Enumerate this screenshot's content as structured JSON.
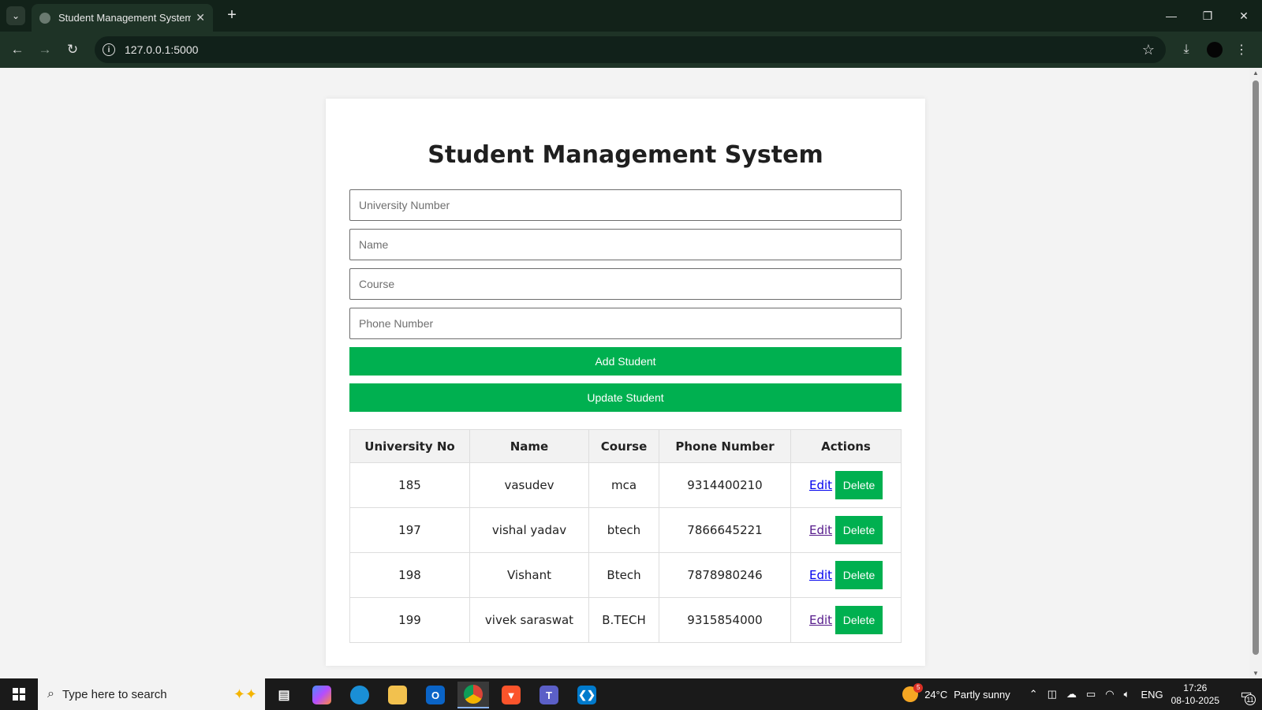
{
  "browser": {
    "tab_title": "Student Management System",
    "url": "127.0.0.1:5000"
  },
  "page": {
    "title": "Student Management System",
    "form": {
      "university_number_placeholder": "University Number",
      "name_placeholder": "Name",
      "course_placeholder": "Course",
      "phone_placeholder": "Phone Number",
      "add_label": "Add Student",
      "update_label": "Update Student"
    },
    "table": {
      "headers": [
        "University No",
        "Name",
        "Course",
        "Phone Number",
        "Actions"
      ],
      "rows": [
        {
          "university_no": "185",
          "name": "vasudev",
          "course": "mca",
          "phone": "9314400210"
        },
        {
          "university_no": "197",
          "name": "vishal yadav",
          "course": "btech",
          "phone": "7866645221"
        },
        {
          "university_no": "198",
          "name": "Vishant",
          "course": "Btech",
          "phone": "7878980246"
        },
        {
          "university_no": "199",
          "name": "vivek saraswat",
          "course": "B.TECH",
          "phone": "9315854000"
        }
      ],
      "edit_label": "Edit",
      "delete_label": "Delete"
    }
  },
  "taskbar": {
    "search_placeholder": "Type here to search",
    "weather_temp": "24°C",
    "weather_desc": "Partly sunny",
    "weather_badge": "5",
    "language": "ENG",
    "time": "17:26",
    "date": "08-10-2025",
    "notification_count": "11"
  },
  "colors": {
    "accent_green": "#00b050",
    "chrome_dark": "#122219",
    "chrome_toolbar": "#1e3326"
  }
}
